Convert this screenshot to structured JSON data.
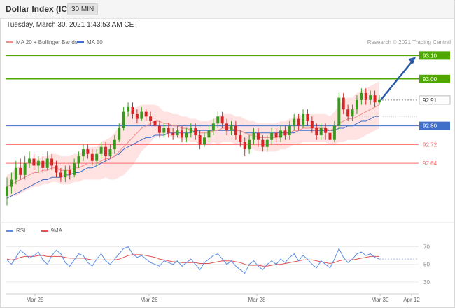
{
  "header": {
    "title": "Dollar Index (ICE)",
    "timeframe": "30 MIN"
  },
  "timestamp": "Tuesday, March 30, 2021 1:43:53 AM CET",
  "legend": {
    "ma20_bb": "MA 20 + Bollinger Bands",
    "ma50": "MA 50"
  },
  "credit": "Research © 2021 Trading Central",
  "colors": {
    "up": "#3a9a1e",
    "down": "#d42626",
    "ma20": "#f28c8c",
    "ma50": "#3f6fc9",
    "band_fill": "#ffe2e2",
    "resistance": "#4ea800",
    "pivot": "#3f6fc9",
    "support": "#ff6b6b",
    "arrow": "#2a5ba8",
    "rsi": "#5b8ee6",
    "rsi_ma": "#e05252"
  },
  "chart_data": [
    {
      "type": "candlestick",
      "symbol": "Dollar Index (ICE)",
      "interval": "30 MIN",
      "y_range": [
        92.44,
        93.14
      ],
      "x_ticks": [
        "Mar 25",
        "Mar 26",
        "Mar 28",
        "Mar 30",
        "Apr 12"
      ],
      "last_price": 92.91,
      "levels": [
        {
          "label": "93.10",
          "value": 93.1,
          "kind": "resistance"
        },
        {
          "label": "93.00",
          "value": 93.0,
          "kind": "resistance"
        },
        {
          "label": "92.80",
          "value": 92.8,
          "kind": "pivot"
        },
        {
          "label": "92.72",
          "value": 92.72,
          "kind": "support"
        },
        {
          "label": "92.64",
          "value": 92.64,
          "kind": "support"
        }
      ],
      "forecast_target": 93.1,
      "candles": [
        [
          92.5,
          92.54,
          92.58,
          92.46
        ],
        [
          92.54,
          92.57,
          92.6,
          92.51
        ],
        [
          92.57,
          92.62,
          92.65,
          92.55
        ],
        [
          92.62,
          92.59,
          92.66,
          92.57
        ],
        [
          92.59,
          92.64,
          92.67,
          92.57
        ],
        [
          92.64,
          92.66,
          92.69,
          92.62
        ],
        [
          92.66,
          92.63,
          92.68,
          92.61
        ],
        [
          92.63,
          92.65,
          92.67,
          92.6
        ],
        [
          92.65,
          92.62,
          92.67,
          92.6
        ],
        [
          92.62,
          92.66,
          92.69,
          92.61
        ],
        [
          92.66,
          92.63,
          92.68,
          92.61
        ],
        [
          92.63,
          92.6,
          92.65,
          92.58
        ],
        [
          92.6,
          92.58,
          92.62,
          92.56
        ],
        [
          92.58,
          92.61,
          92.63,
          92.56
        ],
        [
          92.61,
          92.59,
          92.63,
          92.57
        ],
        [
          92.59,
          92.64,
          92.66,
          92.58
        ],
        [
          92.64,
          92.67,
          92.69,
          92.62
        ],
        [
          92.67,
          92.7,
          92.72,
          92.65
        ],
        [
          92.7,
          92.68,
          92.72,
          92.66
        ],
        [
          92.68,
          92.65,
          92.7,
          92.63
        ],
        [
          92.65,
          92.68,
          92.7,
          92.63
        ],
        [
          92.68,
          92.71,
          92.73,
          92.66
        ],
        [
          92.71,
          92.67,
          92.73,
          92.65
        ],
        [
          92.67,
          92.7,
          92.72,
          92.66
        ],
        [
          92.7,
          92.74,
          92.76,
          92.68
        ],
        [
          92.74,
          92.79,
          92.81,
          92.73
        ],
        [
          92.79,
          92.86,
          92.88,
          92.78
        ],
        [
          92.86,
          92.88,
          92.9,
          92.84
        ],
        [
          92.88,
          92.85,
          92.9,
          92.83
        ],
        [
          92.85,
          92.83,
          92.87,
          92.81
        ],
        [
          92.83,
          92.86,
          92.88,
          92.82
        ],
        [
          92.86,
          92.84,
          92.87,
          92.82
        ],
        [
          92.84,
          92.82,
          92.86,
          92.8
        ],
        [
          92.82,
          92.8,
          92.84,
          92.78
        ],
        [
          92.8,
          92.77,
          92.82,
          92.75
        ],
        [
          92.77,
          92.79,
          92.81,
          92.75
        ],
        [
          92.79,
          92.77,
          92.81,
          92.75
        ],
        [
          92.77,
          92.76,
          92.79,
          92.74
        ],
        [
          92.76,
          92.78,
          92.8,
          92.75
        ],
        [
          92.78,
          92.75,
          92.8,
          92.73
        ],
        [
          92.75,
          92.77,
          92.79,
          92.73
        ],
        [
          92.77,
          92.79,
          92.81,
          92.75
        ],
        [
          92.79,
          92.76,
          92.81,
          92.74
        ],
        [
          92.76,
          92.72,
          92.78,
          92.7
        ],
        [
          92.72,
          92.75,
          92.77,
          92.71
        ],
        [
          92.75,
          92.78,
          92.8,
          92.73
        ],
        [
          92.78,
          92.81,
          92.83,
          92.76
        ],
        [
          92.81,
          92.84,
          92.86,
          92.79
        ],
        [
          92.84,
          92.81,
          92.86,
          92.79
        ],
        [
          92.81,
          92.78,
          92.83,
          92.76
        ],
        [
          92.78,
          92.8,
          92.82,
          92.76
        ],
        [
          92.8,
          92.76,
          92.82,
          92.74
        ],
        [
          92.76,
          92.73,
          92.78,
          92.71
        ],
        [
          92.73,
          92.7,
          92.75,
          92.67
        ],
        [
          92.7,
          92.74,
          92.76,
          92.68
        ],
        [
          92.74,
          92.77,
          92.79,
          92.72
        ],
        [
          92.77,
          92.74,
          92.79,
          92.71
        ],
        [
          92.74,
          92.71,
          92.76,
          92.69
        ],
        [
          92.71,
          92.74,
          92.76,
          92.69
        ],
        [
          92.74,
          92.77,
          92.79,
          92.72
        ],
        [
          92.77,
          92.75,
          92.79,
          92.73
        ],
        [
          92.75,
          92.78,
          92.8,
          92.73
        ],
        [
          92.78,
          92.76,
          92.8,
          92.74
        ],
        [
          92.76,
          92.8,
          92.82,
          92.74
        ],
        [
          92.8,
          92.83,
          92.85,
          92.78
        ],
        [
          92.83,
          92.8,
          92.85,
          92.78
        ],
        [
          92.8,
          92.85,
          92.87,
          92.79
        ],
        [
          92.85,
          92.82,
          92.87,
          92.8
        ],
        [
          92.82,
          92.79,
          92.84,
          92.77
        ],
        [
          92.79,
          92.76,
          92.81,
          92.74
        ],
        [
          92.76,
          92.79,
          92.81,
          92.74
        ],
        [
          92.79,
          92.77,
          92.81,
          92.74
        ],
        [
          92.77,
          92.74,
          92.79,
          92.72
        ],
        [
          92.74,
          92.8,
          92.82,
          92.73
        ],
        [
          92.8,
          92.92,
          92.94,
          92.78
        ],
        [
          92.92,
          92.87,
          92.94,
          92.85
        ],
        [
          92.87,
          92.84,
          92.89,
          92.82
        ],
        [
          92.84,
          92.87,
          92.89,
          92.82
        ],
        [
          92.87,
          92.91,
          92.93,
          92.85
        ],
        [
          92.91,
          92.94,
          92.96,
          92.89
        ],
        [
          92.94,
          92.91,
          92.96,
          92.89
        ],
        [
          92.91,
          92.93,
          92.95,
          92.89
        ],
        [
          92.93,
          92.9,
          92.95,
          92.88
        ],
        [
          92.9,
          92.91,
          92.93,
          92.89
        ]
      ],
      "ma20": [
        92.54,
        92.55,
        92.56,
        92.57,
        92.58,
        92.59,
        92.6,
        92.6,
        92.61,
        92.61,
        92.62,
        92.62,
        92.61,
        92.61,
        92.61,
        92.62,
        92.62,
        92.63,
        92.64,
        92.64,
        92.64,
        92.65,
        92.66,
        92.66,
        92.67,
        92.69,
        92.71,
        92.73,
        92.75,
        92.77,
        92.79,
        92.8,
        92.81,
        92.82,
        92.82,
        92.81,
        92.81,
        92.8,
        92.8,
        92.79,
        92.79,
        92.78,
        92.78,
        92.77,
        92.77,
        92.77,
        92.78,
        92.78,
        92.79,
        92.79,
        92.79,
        92.78,
        92.78,
        92.77,
        92.76,
        92.76,
        92.75,
        92.75,
        92.75,
        92.75,
        92.75,
        92.76,
        92.76,
        92.77,
        92.78,
        92.78,
        92.79,
        92.79,
        92.79,
        92.79,
        92.79,
        92.79,
        92.78,
        92.79,
        92.81,
        92.82,
        92.83,
        92.83,
        92.84,
        92.85,
        92.86,
        92.87,
        92.88,
        92.89
      ],
      "bb_width": [
        0.05,
        0.05,
        0.06,
        0.06,
        0.06,
        0.06,
        0.06,
        0.06,
        0.06,
        0.06,
        0.06,
        0.06,
        0.06,
        0.06,
        0.06,
        0.06,
        0.06,
        0.06,
        0.07,
        0.07,
        0.07,
        0.08,
        0.08,
        0.09,
        0.1,
        0.11,
        0.12,
        0.12,
        0.12,
        0.11,
        0.1,
        0.09,
        0.08,
        0.07,
        0.06,
        0.05,
        0.05,
        0.05,
        0.05,
        0.05,
        0.05,
        0.05,
        0.05,
        0.05,
        0.05,
        0.05,
        0.05,
        0.06,
        0.06,
        0.06,
        0.06,
        0.06,
        0.06,
        0.06,
        0.06,
        0.06,
        0.06,
        0.06,
        0.06,
        0.06,
        0.06,
        0.06,
        0.06,
        0.06,
        0.06,
        0.06,
        0.06,
        0.06,
        0.06,
        0.06,
        0.06,
        0.06,
        0.06,
        0.07,
        0.08,
        0.09,
        0.09,
        0.09,
        0.1,
        0.1,
        0.1,
        0.1,
        0.1,
        0.1
      ],
      "ma50": [
        92.49,
        92.5,
        92.51,
        92.52,
        92.53,
        92.54,
        92.55,
        92.56,
        92.57,
        92.57,
        92.58,
        92.58,
        92.58,
        92.59,
        92.59,
        92.6,
        92.6,
        92.61,
        92.62,
        92.62,
        92.63,
        92.64,
        92.65,
        92.66,
        92.67,
        92.68,
        92.7,
        92.71,
        92.72,
        92.73,
        92.74,
        92.75,
        92.75,
        92.76,
        92.76,
        92.76,
        92.77,
        92.77,
        92.77,
        92.77,
        92.77,
        92.77,
        92.78,
        92.78,
        92.78,
        92.78,
        92.78,
        92.78,
        92.78,
        92.78,
        92.78,
        92.78,
        92.78,
        92.77,
        92.77,
        92.77,
        92.77,
        92.77,
        92.77,
        92.77,
        92.77,
        92.77,
        92.77,
        92.77,
        92.77,
        92.78,
        92.78,
        92.78,
        92.78,
        92.78,
        92.78,
        92.78,
        92.78,
        92.78,
        92.79,
        92.79,
        92.8,
        92.8,
        92.81,
        92.82,
        92.82,
        92.83,
        92.84,
        92.84
      ]
    },
    {
      "type": "line",
      "title": "RSI",
      "y_range": [
        22,
        76
      ],
      "y_ticks": [
        70,
        50,
        30
      ],
      "series": [
        {
          "name": "RSI",
          "values": [
            55,
            50,
            58,
            66,
            62,
            57,
            60,
            64,
            55,
            50,
            60,
            66,
            62,
            52,
            48,
            55,
            62,
            60,
            52,
            48,
            56,
            62,
            54,
            50,
            56,
            62,
            68,
            70,
            62,
            58,
            60,
            56,
            52,
            50,
            48,
            54,
            52,
            50,
            54,
            48,
            52,
            56,
            50,
            44,
            52,
            56,
            60,
            62,
            56,
            50,
            54,
            48,
            44,
            40,
            50,
            54,
            48,
            44,
            50,
            54,
            50,
            56,
            52,
            58,
            62,
            54,
            60,
            56,
            50,
            46,
            54,
            50,
            46,
            56,
            68,
            58,
            52,
            56,
            62,
            64,
            60,
            62,
            58,
            56
          ]
        },
        {
          "name": "9MA",
          "values": [
            56,
            55,
            56,
            58,
            59,
            59,
            59,
            60,
            60,
            59,
            59,
            59,
            59,
            58,
            57,
            57,
            57,
            57,
            56,
            55,
            55,
            55,
            55,
            55,
            55,
            56,
            58,
            60,
            61,
            61,
            61,
            60,
            59,
            58,
            56,
            55,
            54,
            53,
            53,
            52,
            52,
            52,
            52,
            51,
            51,
            51,
            52,
            53,
            54,
            54,
            54,
            53,
            52,
            50,
            49,
            49,
            49,
            48,
            48,
            49,
            50,
            50,
            51,
            52,
            53,
            54,
            55,
            55,
            55,
            54,
            53,
            52,
            51,
            52,
            54,
            55,
            55,
            55,
            56,
            57,
            58,
            59,
            59,
            59
          ]
        }
      ],
      "last_value": 56
    }
  ]
}
